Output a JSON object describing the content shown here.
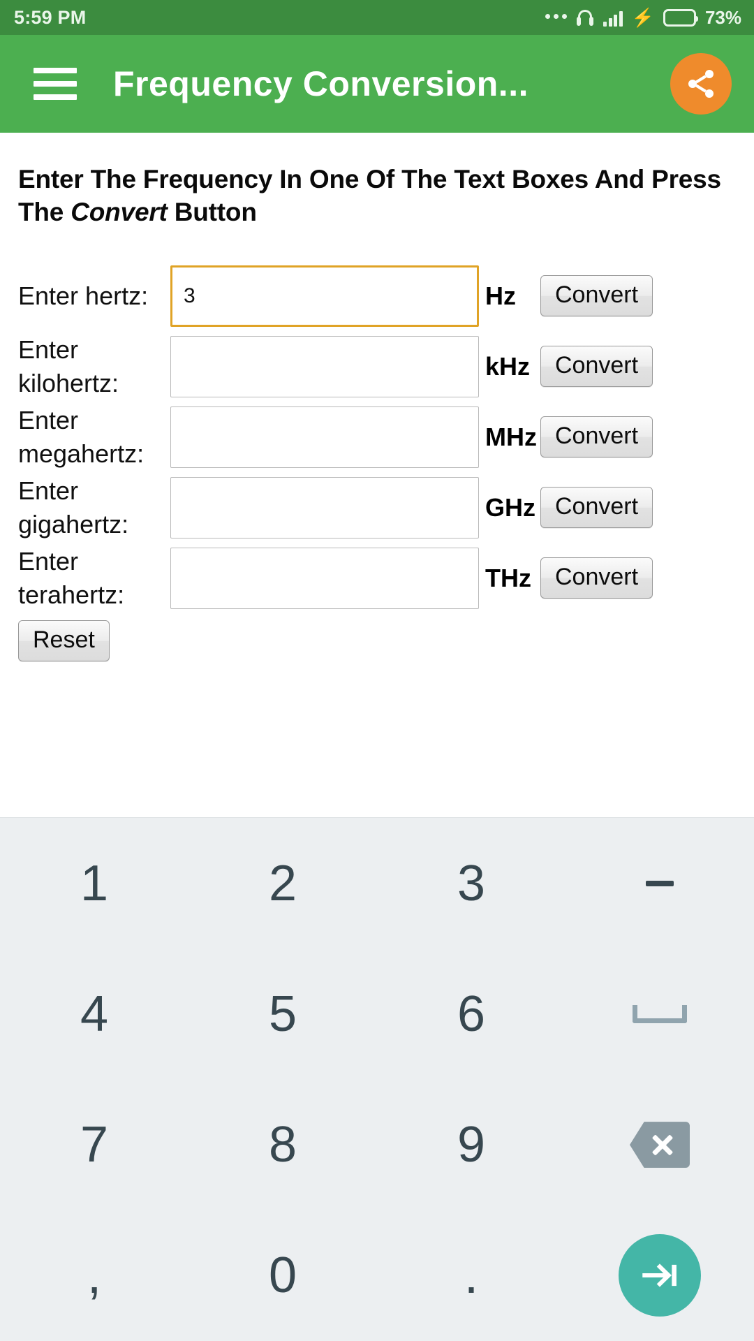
{
  "status_bar": {
    "time": "5:59 PM",
    "battery_percent": "73%",
    "icons": [
      "more-dots-icon",
      "headphone-icon",
      "signal-bars-icon",
      "charging-bolt-icon",
      "battery-icon"
    ]
  },
  "app_bar": {
    "menu_icon": "hamburger-menu-icon",
    "title": "Frequency Conversion...",
    "share_icon": "share-icon",
    "share_color": "#ef8b2c",
    "bar_color": "#4caf50"
  },
  "content": {
    "instructions_part1": "Enter The Frequency In One Of The Text Boxes And Press The ",
    "instructions_emphasis": "Convert",
    "instructions_part2": " Button",
    "rows": [
      {
        "label": "Enter hertz:",
        "value": "3",
        "placeholder": "",
        "unit": "Hz",
        "button": "Convert",
        "focused": true
      },
      {
        "label": "Enter kilohertz:",
        "value": "",
        "placeholder": "",
        "unit": "kHz",
        "button": "Convert",
        "focused": false
      },
      {
        "label": "Enter megahertz:",
        "value": "",
        "placeholder": "",
        "unit": "MHz",
        "button": "Convert",
        "focused": false
      },
      {
        "label": "Enter gigahertz:",
        "value": "",
        "placeholder": "",
        "unit": "GHz",
        "button": "Convert",
        "focused": false
      },
      {
        "label": "Enter terahertz:",
        "value": "",
        "placeholder": "",
        "unit": "THz",
        "button": "Convert",
        "focused": false
      }
    ],
    "reset_label": "Reset",
    "focus_border_color": "#e0a326"
  },
  "keyboard": {
    "type": "numeric",
    "background": "#eceff1",
    "key_color": "#37474f",
    "enter_color": "#44b6a7",
    "keys": [
      {
        "label": "1",
        "name": "key-1",
        "kind": "text"
      },
      {
        "label": "2",
        "name": "key-2",
        "kind": "text"
      },
      {
        "label": "3",
        "name": "key-3",
        "kind": "text"
      },
      {
        "label": "-",
        "name": "key-dash",
        "kind": "dash-icon"
      },
      {
        "label": "4",
        "name": "key-4",
        "kind": "text"
      },
      {
        "label": "5",
        "name": "key-5",
        "kind": "text"
      },
      {
        "label": "6",
        "name": "key-6",
        "kind": "text"
      },
      {
        "label": "space",
        "name": "key-space",
        "kind": "space-icon"
      },
      {
        "label": "7",
        "name": "key-7",
        "kind": "text"
      },
      {
        "label": "8",
        "name": "key-8",
        "kind": "text"
      },
      {
        "label": "9",
        "name": "key-9",
        "kind": "text"
      },
      {
        "label": "backspace",
        "name": "key-backspace",
        "kind": "backspace-icon"
      },
      {
        "label": ",",
        "name": "key-comma",
        "kind": "text"
      },
      {
        "label": "0",
        "name": "key-0",
        "kind": "text"
      },
      {
        "label": ".",
        "name": "key-period",
        "kind": "text"
      },
      {
        "label": "next",
        "name": "key-next",
        "kind": "enter-icon"
      }
    ]
  }
}
